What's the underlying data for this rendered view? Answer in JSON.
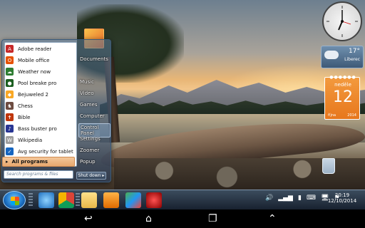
{
  "start_menu": {
    "programs": [
      {
        "label": "Adobe reader",
        "icon": "adobe-reader-icon",
        "color": "#c62828"
      },
      {
        "label": "Mobile office",
        "icon": "mobile-office-icon",
        "color": "#e65100"
      },
      {
        "label": "Weather now",
        "icon": "weather-icon",
        "color": "#2e7d32"
      },
      {
        "label": "Pool breake pro",
        "icon": "pool-icon",
        "color": "#1b5e20"
      },
      {
        "label": "Bejuweled 2",
        "icon": "bejeweled-icon",
        "color": "#f9a825"
      },
      {
        "label": "Chess",
        "icon": "chess-icon",
        "color": "#6d4c41"
      },
      {
        "label": "Bible",
        "icon": "bible-icon",
        "color": "#bf360c"
      },
      {
        "label": "Bass buster pro",
        "icon": "bass-buster-icon",
        "color": "#283593"
      },
      {
        "label": "Wikipedia",
        "icon": "wikipedia-icon",
        "color": "#9e9e9e"
      },
      {
        "label": "Avg security for tablet",
        "icon": "avg-icon",
        "color": "#1565c0"
      }
    ],
    "all_programs": "All programs",
    "search_placeholder": "Search programs & files",
    "right_items": [
      "Documents",
      "Music",
      "Video",
      "Games",
      "Computer",
      "Control Panel",
      "Settings",
      "Zoomer",
      "Popup"
    ],
    "shutdown": "Shut down"
  },
  "gadgets": {
    "weather": {
      "temp": "17°",
      "city": "Liberec"
    },
    "calendar": {
      "day": "neděle",
      "date": "12",
      "month": "října",
      "year": "2014"
    }
  },
  "taskbar": {
    "time": "20:19",
    "date": "12/10/2014",
    "apps": [
      "internet-explorer-icon",
      "chrome-icon",
      "folder-icon",
      "media-player-icon",
      "maps-icon",
      "location-icon"
    ]
  },
  "navbar": {
    "back": "↩",
    "home": "⌂",
    "recent": "❐",
    "up": "⌃"
  }
}
